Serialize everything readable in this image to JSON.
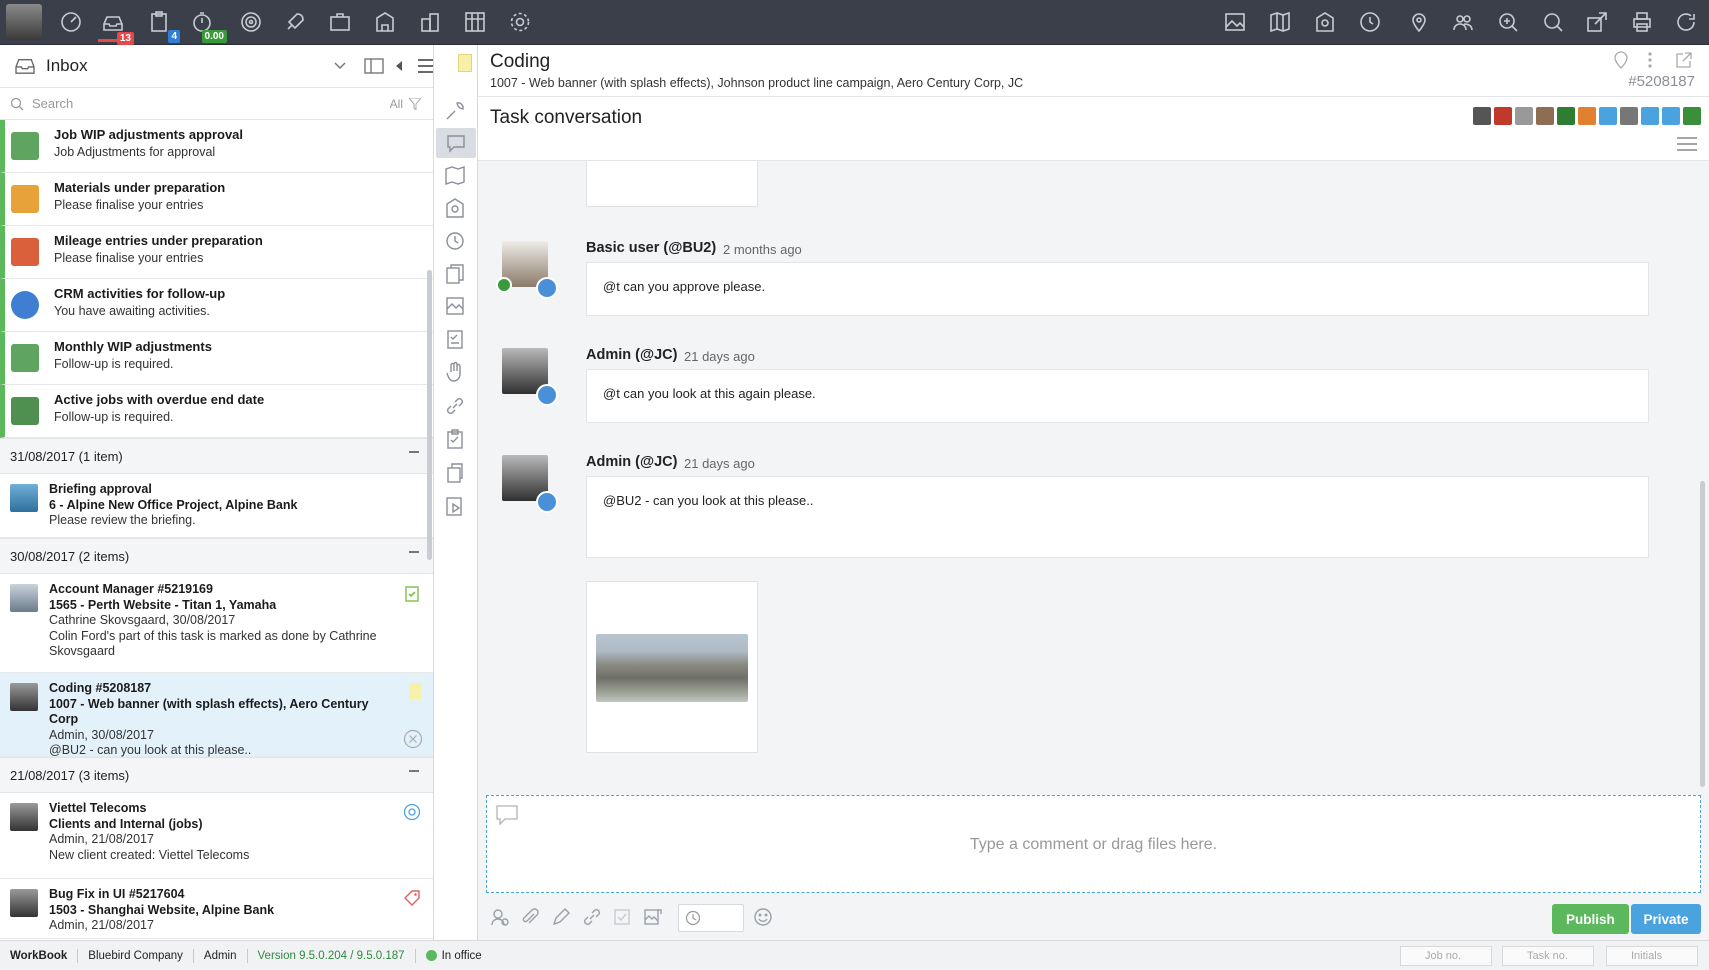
{
  "topbar": {
    "badges": {
      "inbox": "13",
      "tasks": "4",
      "time": "0.00"
    },
    "left_icons": [
      "dashboard-icon",
      "inbox-icon",
      "clipboard-icon",
      "stopwatch-icon",
      "target-icon",
      "rocket-icon",
      "briefcase-icon",
      "building-icon",
      "org-chart-icon",
      "planner-icon",
      "settings-icon"
    ],
    "right_icons": [
      "image-icon",
      "map-icon",
      "finance-icon",
      "clock-icon",
      "location-pin-icon",
      "users-icon",
      "zoom-in-icon",
      "search-icon",
      "export-icon",
      "print-icon",
      "refresh-icon"
    ]
  },
  "inbox": {
    "title": "Inbox",
    "search_placeholder": "Search",
    "filter_label": "All",
    "system_items": [
      {
        "title": "Job WIP adjustments approval",
        "subtitle": "Job Adjustments for approval",
        "color": "#5fa45f"
      },
      {
        "title": "Materials under preparation",
        "subtitle": "Please finalise your entries",
        "color": "#e8a23a"
      },
      {
        "title": "Mileage entries under preparation",
        "subtitle": "Please finalise your entries",
        "color": "#d9603a"
      },
      {
        "title": "CRM activities for follow-up",
        "subtitle": "You have awaiting activities.",
        "color": "#3f7fd1"
      },
      {
        "title": "Monthly WIP adjustments",
        "subtitle": "Follow-up is required.",
        "color": "#5fa45f"
      },
      {
        "title": "Active jobs with overdue end date",
        "subtitle": "Follow-up is required.",
        "color": "#4f8f4f"
      }
    ],
    "groups": [
      {
        "label": "31/08/2017 (1 item)",
        "items": [
          {
            "l1": "Briefing approval",
            "l2": "6 - Alpine New Office Project, Alpine Bank",
            "l3": "Please review the briefing.",
            "l4": ""
          }
        ]
      },
      {
        "label": "30/08/2017 (2 items)",
        "items": [
          {
            "l1": "Account Manager #5219169",
            "l2": "1565 - Perth Website - Titan 1, Yamaha",
            "l3": "Cathrine Skovsgaard, 30/08/2017",
            "l4": "Colin Ford's part of this task is marked as done by Cathrine Skovsgaard"
          },
          {
            "l1": "Coding #5208187",
            "l2": "1007 - Web banner (with splash effects), Aero Century Corp",
            "l3": "Admin, 30/08/2017",
            "l4": "@BU2 - can you look at this please.."
          }
        ]
      },
      {
        "label": "21/08/2017 (3 items)",
        "items": [
          {
            "l1": "Viettel Telecoms",
            "l2": "Clients and Internal (jobs)",
            "l3": "Admin, 21/08/2017",
            "l4": "New client created: Viettel Telecoms"
          },
          {
            "l1": "Bug Fix in UI #5217604",
            "l2": "1503 - Shanghai Website, Alpine Bank",
            "l3": "Admin, 21/08/2017",
            "l4": ""
          }
        ]
      }
    ]
  },
  "task": {
    "name": "Coding",
    "description": "1007 - Web banner (with splash effects), Johnson product line campaign, Aero Century Corp, JC",
    "number": "#5208187"
  },
  "conversation": {
    "title": "Task conversation",
    "participant_colors": [
      "#555",
      "#c0392b",
      "#999",
      "#8e6e53",
      "#2e7d32",
      "#e08030",
      "#4aa3df",
      "#777",
      "#4aa3df",
      "#4aa3df",
      "#3b8f3b"
    ],
    "messages": [
      {
        "author": "Basic user (@BU2)",
        "when": "2 months ago",
        "text": "@t can you approve please."
      },
      {
        "author": "Admin (@JC)",
        "when": "21 days ago",
        "text": "@t can you look at this again please."
      },
      {
        "author": "Admin (@JC)",
        "when": "21 days ago",
        "text": "@BU2 - can you look at this please.."
      }
    ],
    "composer_placeholder": "Type a comment or drag files here.",
    "publish_label": "Publish",
    "private_label": "Private"
  },
  "statusbar": {
    "app": "WorkBook",
    "company": "Bluebird Company",
    "user": "Admin",
    "version": "Version 9.5.0.204 / 9.5.0.187",
    "presence": "In office",
    "job_placeholder": "Job no.",
    "task_placeholder": "Task no.",
    "initials_placeholder": "Initials"
  }
}
